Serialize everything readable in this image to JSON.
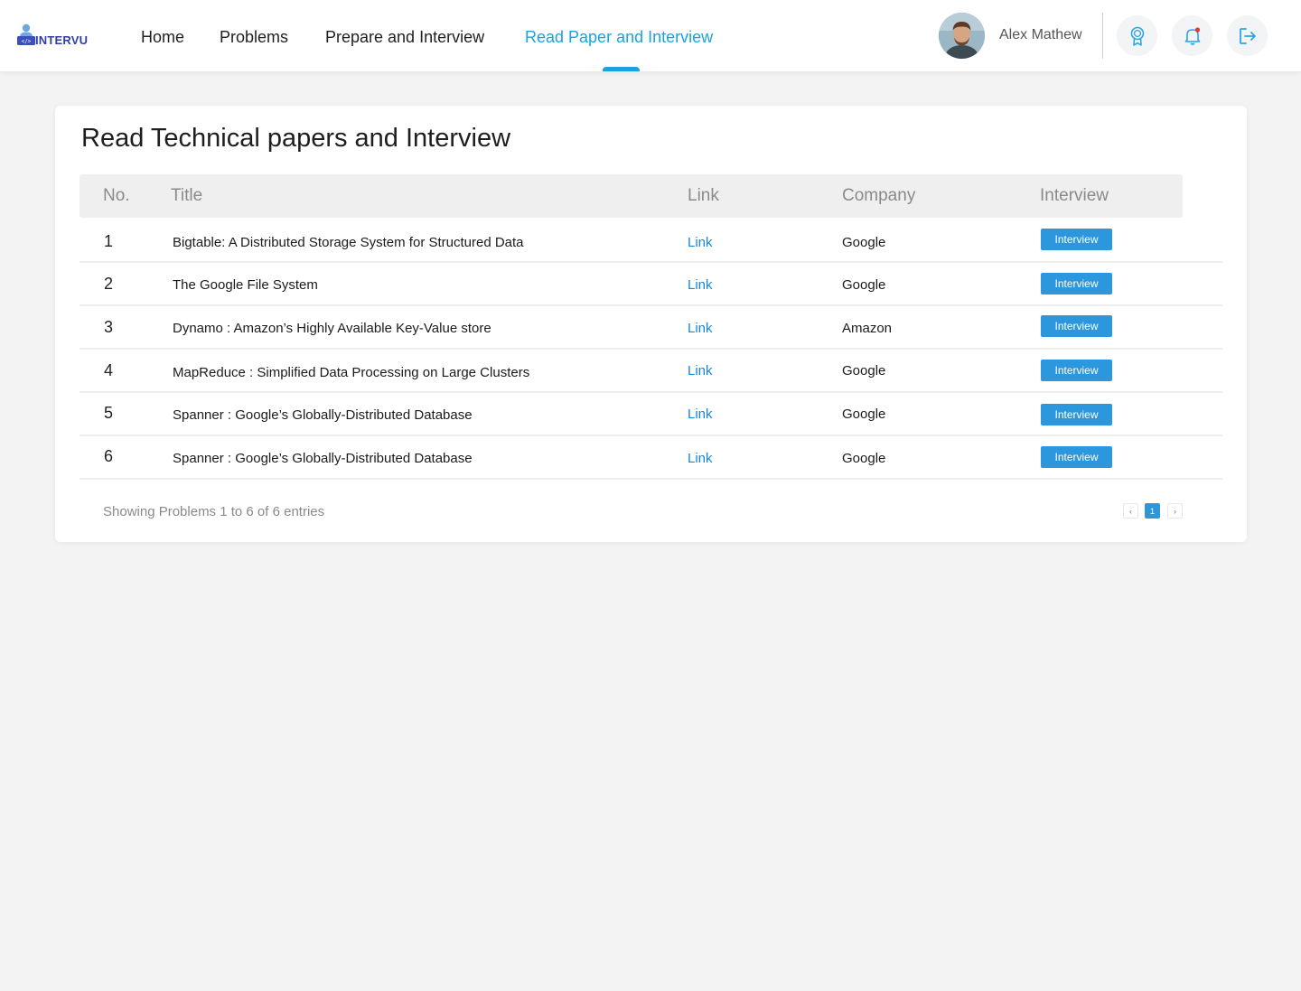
{
  "brand": {
    "name": "INTERVU"
  },
  "nav": {
    "items": [
      {
        "label": "Home"
      },
      {
        "label": "Problems"
      },
      {
        "label": "Prepare and Interview"
      },
      {
        "label": "Read Paper and Interview"
      }
    ],
    "active": "Read Paper and Interview"
  },
  "user": {
    "name": "Alex Mathew"
  },
  "header_icons": [
    "award-icon",
    "bell-icon",
    "logout-icon"
  ],
  "colors": {
    "accent": "#1aa3de",
    "button": "#2d97dd",
    "link": "#1a86d6",
    "notification_dot": "#e53935"
  },
  "page": {
    "title": "Read Technical papers and Interview",
    "columns": [
      "No.",
      "Title",
      "Link",
      "Company",
      "Interview"
    ],
    "rows": [
      {
        "no": "1",
        "title": "Bigtable: A Distributed Storage System for Structured Data",
        "link": "Link",
        "company": "Google",
        "action": "Interview"
      },
      {
        "no": "2",
        "title": "The Google File System",
        "link": "Link",
        "company": "Google",
        "action": "Interview"
      },
      {
        "no": "3",
        "title": "Dynamo : Amazon’s Highly Available Key-Value store",
        "link": "Link",
        "company": "Amazon",
        "action": "Interview"
      },
      {
        "no": "4",
        "title": "MapReduce : Simplified Data Processing on Large Clusters",
        "link": "Link",
        "company": "Google",
        "action": "Interview"
      },
      {
        "no": "5",
        "title": "Spanner : Google’s Globally-Distributed Database",
        "link": "Link",
        "company": "Google",
        "action": "Interview"
      },
      {
        "no": "6",
        "title": "Spanner : Google’s Globally-Distributed Database",
        "link": "Link",
        "company": "Google",
        "action": "Interview"
      }
    ],
    "footer": "Showing Problems 1 to 6 of 6 entries",
    "pagination": {
      "prev": "‹",
      "current": "1",
      "next": "›"
    }
  }
}
